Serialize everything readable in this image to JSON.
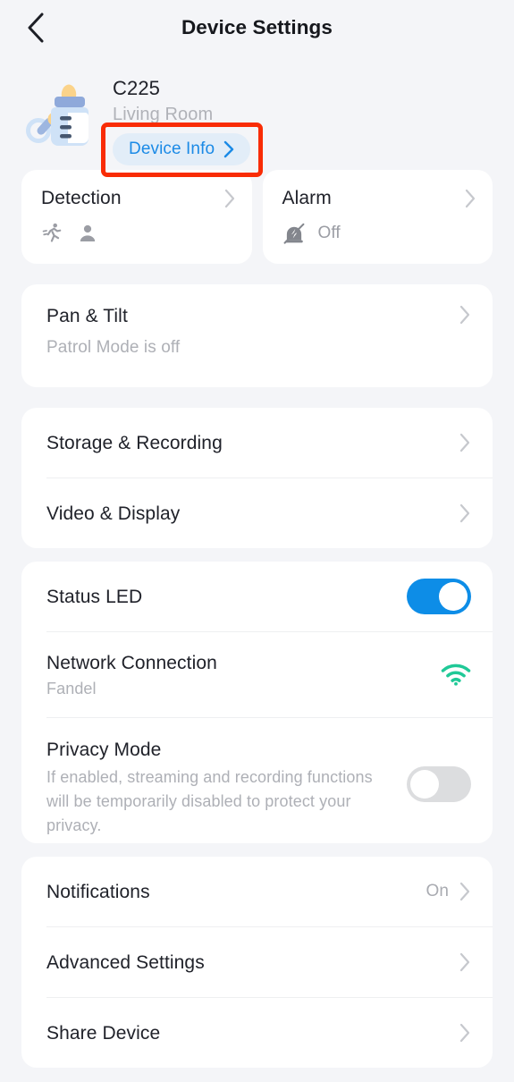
{
  "header": {
    "back_icon": "chevron-left-icon",
    "title": "Device Settings"
  },
  "device": {
    "icon": "baby-bottle-icon",
    "name": "C225",
    "room": "Living Room",
    "info_button_label": "Device Info",
    "info_button_icon": "chevron-right-icon",
    "highlight_color": "#f92c05"
  },
  "quick_cards": [
    {
      "title": "Detection",
      "chevron": "chevron-right-icon",
      "icons": [
        "motion-detection-icon",
        "person-detection-icon"
      ],
      "status": ""
    },
    {
      "title": "Alarm",
      "chevron": "chevron-right-icon",
      "icons": [
        "siren-off-icon"
      ],
      "status": "Off"
    }
  ],
  "pan_tilt": {
    "title": "Pan & Tilt",
    "subtitle": "Patrol Mode is off",
    "chevron": "chevron-right-icon"
  },
  "media_group": [
    {
      "title": "Storage & Recording",
      "chevron": "chevron-right-icon"
    },
    {
      "title": "Video & Display",
      "chevron": "chevron-right-icon"
    }
  ],
  "device_group": {
    "status_led": {
      "title": "Status LED",
      "toggle_state": "on",
      "toggle_on_color": "#0d8de7"
    },
    "network": {
      "title": "Network Connection",
      "subtitle": "Fandel",
      "icon": "wifi-icon",
      "icon_color": "#20c997"
    },
    "privacy": {
      "title": "Privacy Mode",
      "subtitle": "If enabled, streaming and recording functions will be temporarily disabled to protect your privacy.",
      "toggle_state": "off",
      "toggle_off_color": "#dcdddf"
    }
  },
  "bottom_group": [
    {
      "title": "Notifications",
      "value": "On",
      "chevron": "chevron-right-icon"
    },
    {
      "title": "Advanced Settings",
      "value": "",
      "chevron": "chevron-right-icon"
    },
    {
      "title": "Share Device",
      "value": "",
      "chevron": "chevron-right-icon"
    }
  ]
}
